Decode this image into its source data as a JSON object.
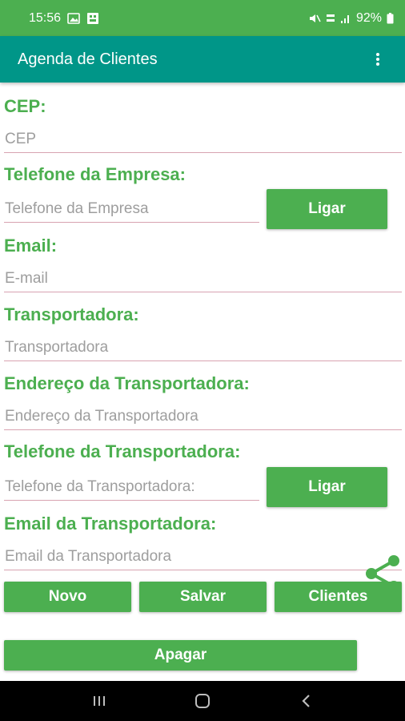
{
  "status_bar": {
    "time": "15:56",
    "battery": "92%",
    "icons": [
      "gallery-icon",
      "app-icon",
      "mute-icon",
      "data-speed-icon",
      "signal-icon",
      "battery-icon"
    ]
  },
  "app_bar": {
    "title": "Agenda de Clientes",
    "menu_icon": "more-vert-icon"
  },
  "form": {
    "cep": {
      "label": "CEP:",
      "placeholder": "CEP"
    },
    "telefone_empresa": {
      "label": "Telefone da Empresa:",
      "placeholder": "Telefone da Empresa",
      "button": "Ligar"
    },
    "email": {
      "label": "Email:",
      "placeholder": "E-mail"
    },
    "transportadora": {
      "label": "Transportadora:",
      "placeholder": "Transportadora"
    },
    "endereco_transportadora": {
      "label": "Endereço da Transportadora:",
      "placeholder": "Endereço da Transportadora"
    },
    "telefone_transportadora": {
      "label": "Telefone da Transportadora:",
      "placeholder": "Telefone da Transportadora:",
      "button": "Ligar"
    },
    "email_transportadora": {
      "label": "Email da Transportadora:",
      "placeholder": "Email da Transportadora"
    }
  },
  "actions": {
    "novo": "Novo",
    "salvar": "Salvar",
    "clientes": "Clientes",
    "apagar": "Apagar",
    "share_icon": "share-icon"
  },
  "nav_bar": {
    "icons": [
      "recents-icon",
      "home-icon",
      "back-icon"
    ]
  },
  "colors": {
    "status_bar": "#4caf50",
    "app_bar": "#009688",
    "accent": "#4caf50",
    "underline": "#d8a3b1",
    "hint": "#9e9e9e"
  }
}
